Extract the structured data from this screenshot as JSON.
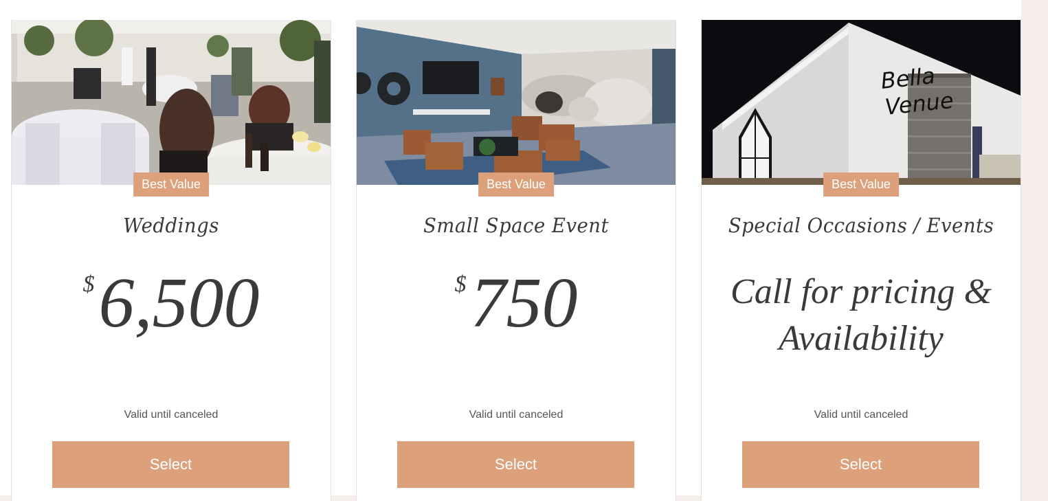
{
  "plans": [
    {
      "ribbon": "Best Value",
      "title": "Weddings",
      "currency": "$",
      "price": "6,500",
      "validity": "Valid until canceled",
      "button": "Select"
    },
    {
      "ribbon": "Best Value",
      "title": "Small Space Event",
      "currency": "$",
      "price": "750",
      "validity": "Valid until canceled",
      "button": "Select"
    },
    {
      "ribbon": "Best Value",
      "title": "Special Occasions / Events",
      "price_text": "Call for pricing & Availability",
      "validity": "Valid until canceled",
      "button": "Select"
    }
  ],
  "venue_sign": [
    "Bella",
    "Venue"
  ],
  "colors": {
    "accent": "#dca07a",
    "text": "#3a3a3a",
    "background": "#f6eeec"
  }
}
